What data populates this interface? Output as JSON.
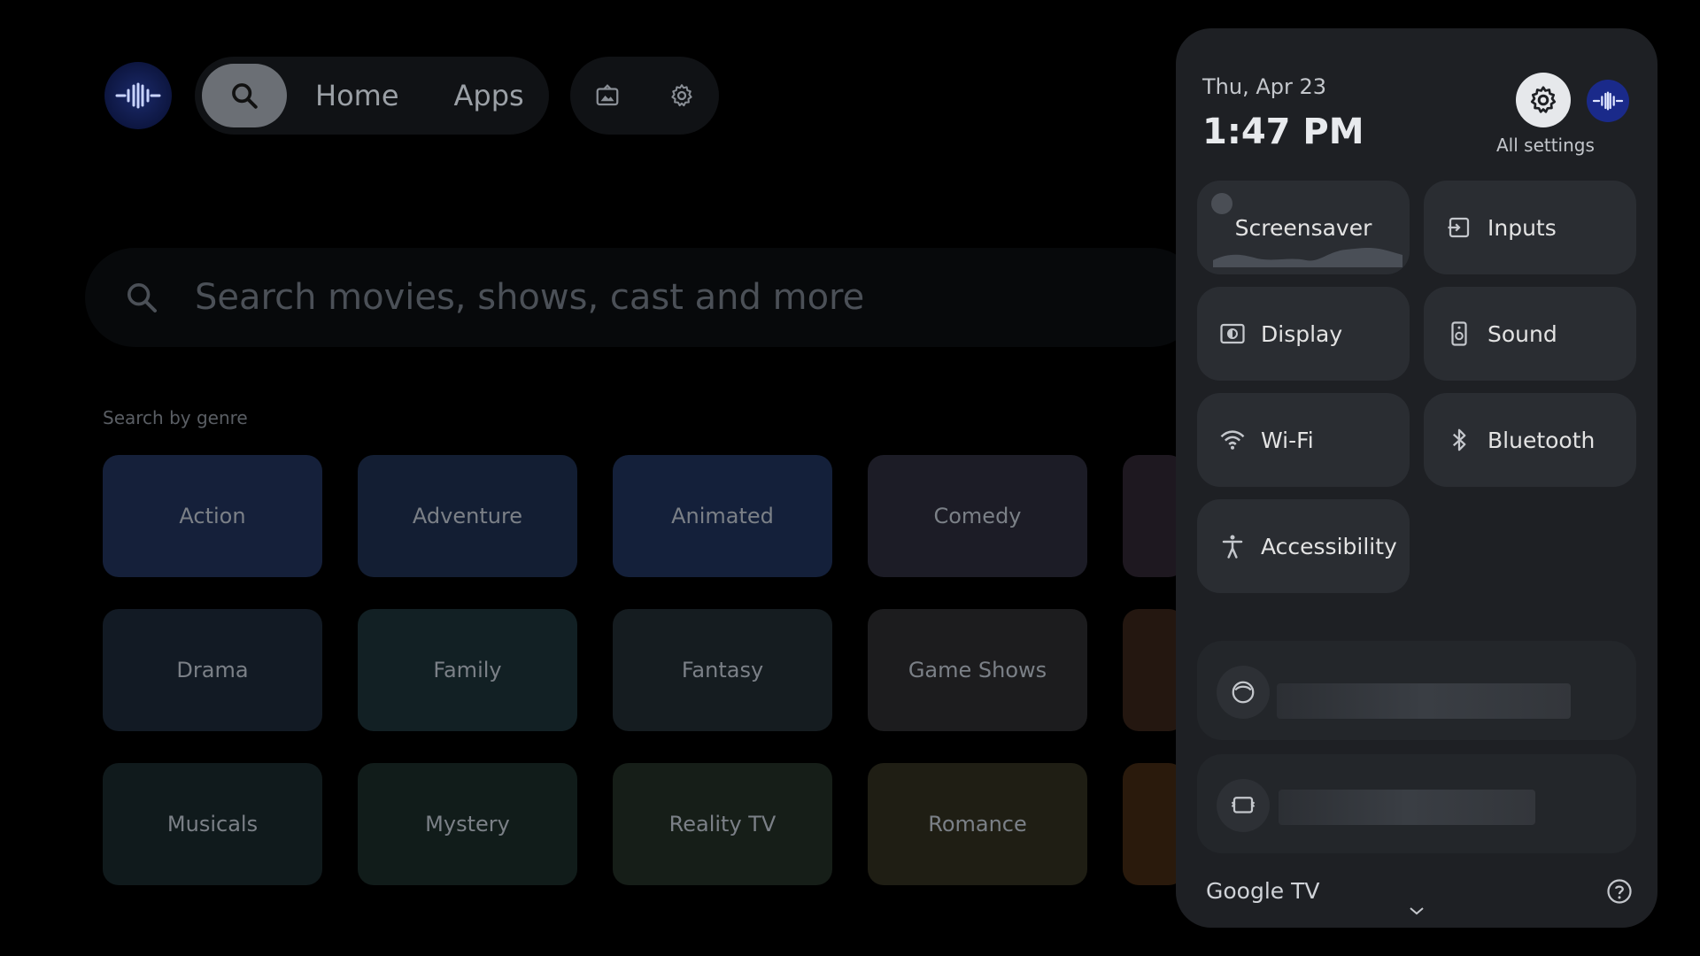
{
  "nav": {
    "home_label": "Home",
    "apps_label": "Apps"
  },
  "search": {
    "placeholder": "Search movies, shows, cast and more",
    "genre_heading": "Search by genre"
  },
  "genres": [
    {
      "label": "Action",
      "color": "#15203a"
    },
    {
      "label": "Adventure",
      "color": "#131e33"
    },
    {
      "label": "Animated",
      "color": "#14203a"
    },
    {
      "label": "Comedy",
      "color": "#1c1c26"
    },
    {
      "label": "Drama",
      "color": "#121a24"
    },
    {
      "label": "Family",
      "color": "#122024"
    },
    {
      "label": "Fantasy",
      "color": "#151c20"
    },
    {
      "label": "Game Shows",
      "color": "#1c1c1e"
    },
    {
      "label": "Musicals",
      "color": "#101a1c"
    },
    {
      "label": "Mystery",
      "color": "#111c1a"
    },
    {
      "label": "Reality TV",
      "color": "#161e18"
    },
    {
      "label": "Romance",
      "color": "#1f1e14"
    }
  ],
  "panel": {
    "date": "Thu, Apr 23",
    "time": "1:47 PM",
    "all_settings_label": "All settings",
    "tiles": {
      "screensaver": "Screensaver",
      "inputs": "Inputs",
      "display": "Display",
      "sound": "Sound",
      "wifi": "Wi-Fi",
      "bluetooth": "Bluetooth",
      "accessibility": "Accessibility"
    },
    "brand": "Google TV"
  }
}
